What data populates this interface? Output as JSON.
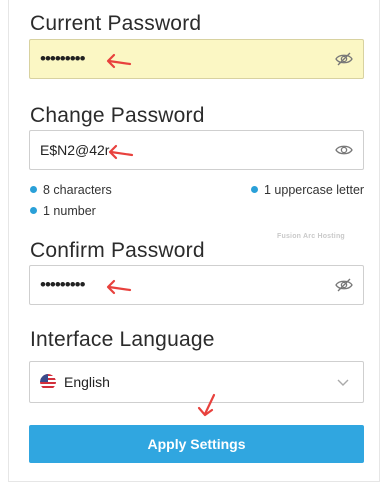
{
  "current_password": {
    "label": "Current Password",
    "value": "•••••••••"
  },
  "change_password": {
    "label": "Change Password",
    "value": "E$N2@42r",
    "requirements": [
      "8 characters",
      "1 uppercase letter",
      "1 number"
    ]
  },
  "confirm_password": {
    "label": "Confirm Password",
    "value": "•••••••••"
  },
  "interface_language": {
    "label": "Interface Language",
    "selected": "English"
  },
  "watermark": "Fusion Arc Hosting",
  "apply_button": {
    "label": "Apply Settings"
  },
  "colors": {
    "accent": "#30a6e0",
    "arrow": "#e8413d",
    "autofill": "#fbf7c4",
    "bullet": "#2aa0d8"
  },
  "icons": {
    "current_toggle": "eye-slash-icon",
    "change_toggle": "eye-icon",
    "confirm_toggle": "eye-slash-icon",
    "language_flag": "us-flag-icon",
    "language_dropdown": "chevron-down-icon",
    "annotation": "red-arrow-icon"
  }
}
